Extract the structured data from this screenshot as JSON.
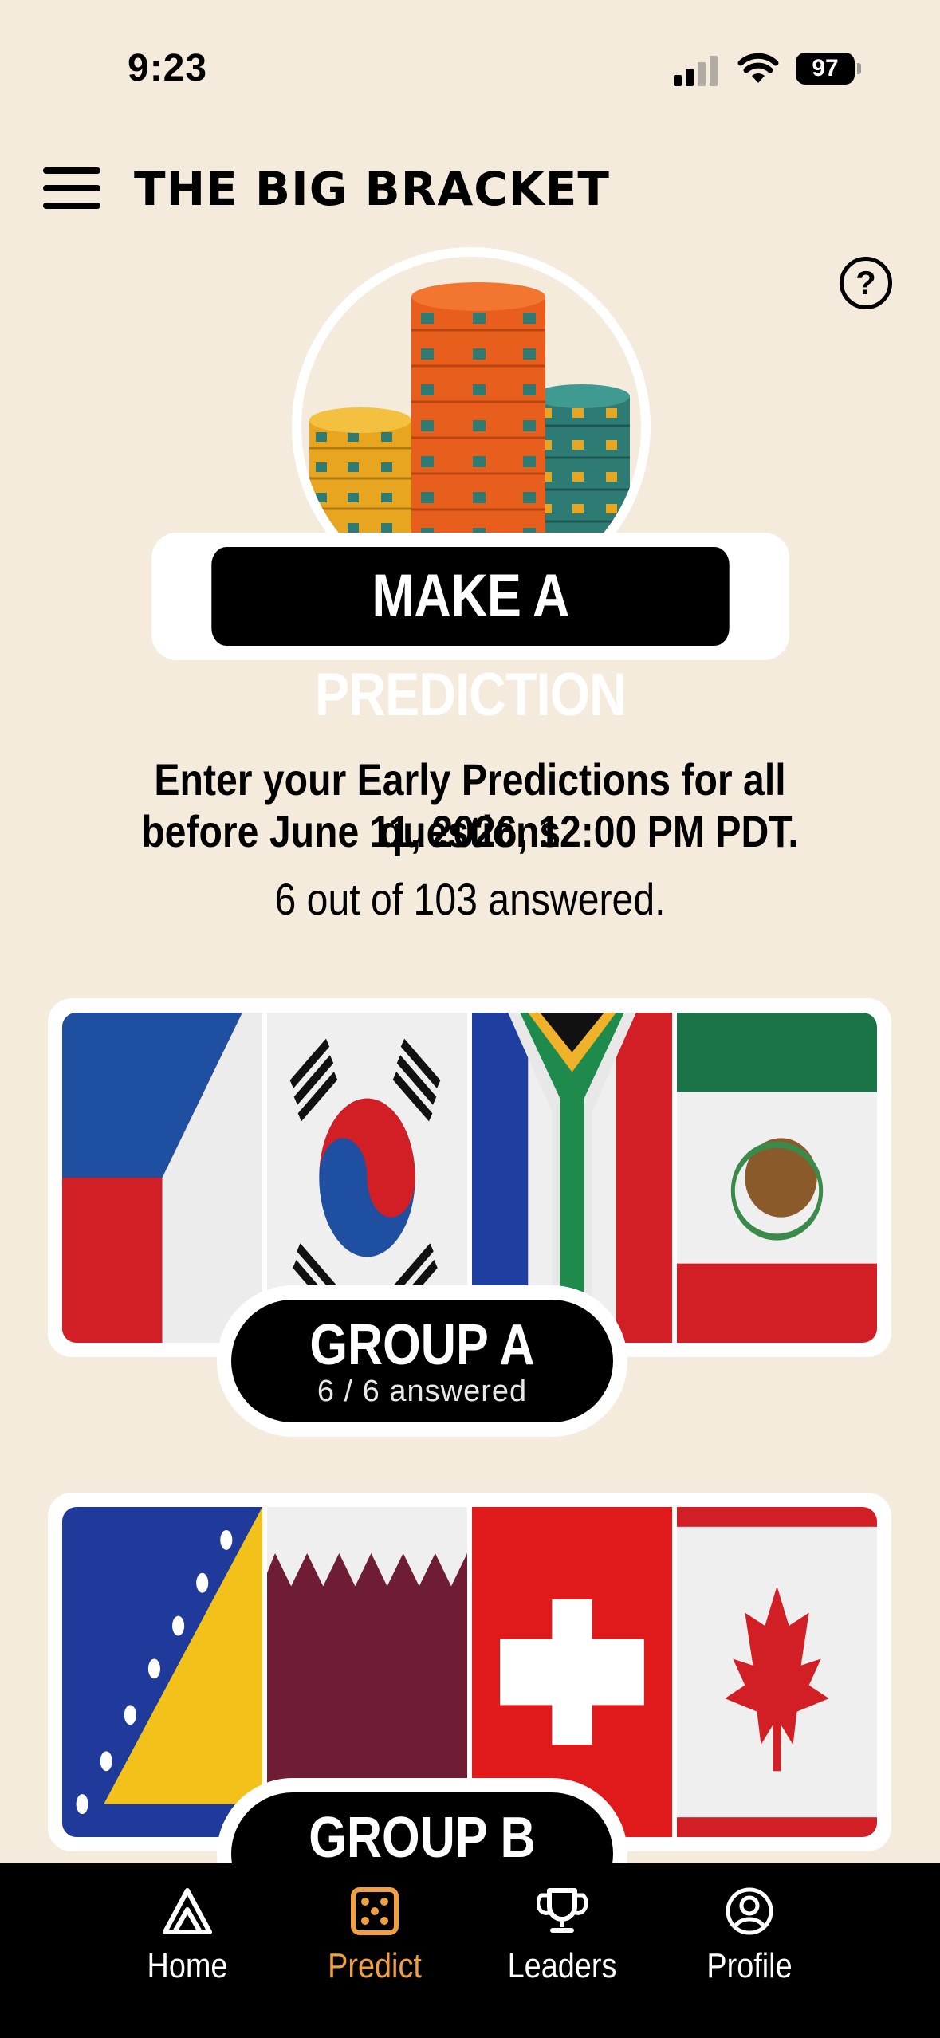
{
  "status_bar": {
    "time": "9:23",
    "battery": "97"
  },
  "header": {
    "title": "THE BIG BRACKET",
    "menu_icon": "hamburger-icon",
    "help_icon": "question-mark-icon"
  },
  "hero": {
    "button_label": "MAKE A PREDICTION"
  },
  "info": {
    "line1": "Enter your Early Predictions for all questions",
    "line2": "before June 11, 2026, 12:00 PM PDT.",
    "progress": "6 out of 103 answered."
  },
  "groups": [
    {
      "name": "GROUP A",
      "answered": "6 / 6 answered",
      "flags": [
        "czechia",
        "south-korea",
        "south-africa",
        "mexico"
      ]
    },
    {
      "name": "GROUP B",
      "flags": [
        "bosnia",
        "qatar",
        "switzerland",
        "canada"
      ]
    }
  ],
  "bottom_nav": {
    "items": [
      {
        "label": "Home",
        "icon": "home-triangle-icon"
      },
      {
        "label": "Predict",
        "icon": "dice-icon",
        "active": true
      },
      {
        "label": "Leaders",
        "icon": "trophy-icon"
      },
      {
        "label": "Profile",
        "icon": "user-circle-icon"
      }
    ],
    "active_color": "#f0a040"
  }
}
